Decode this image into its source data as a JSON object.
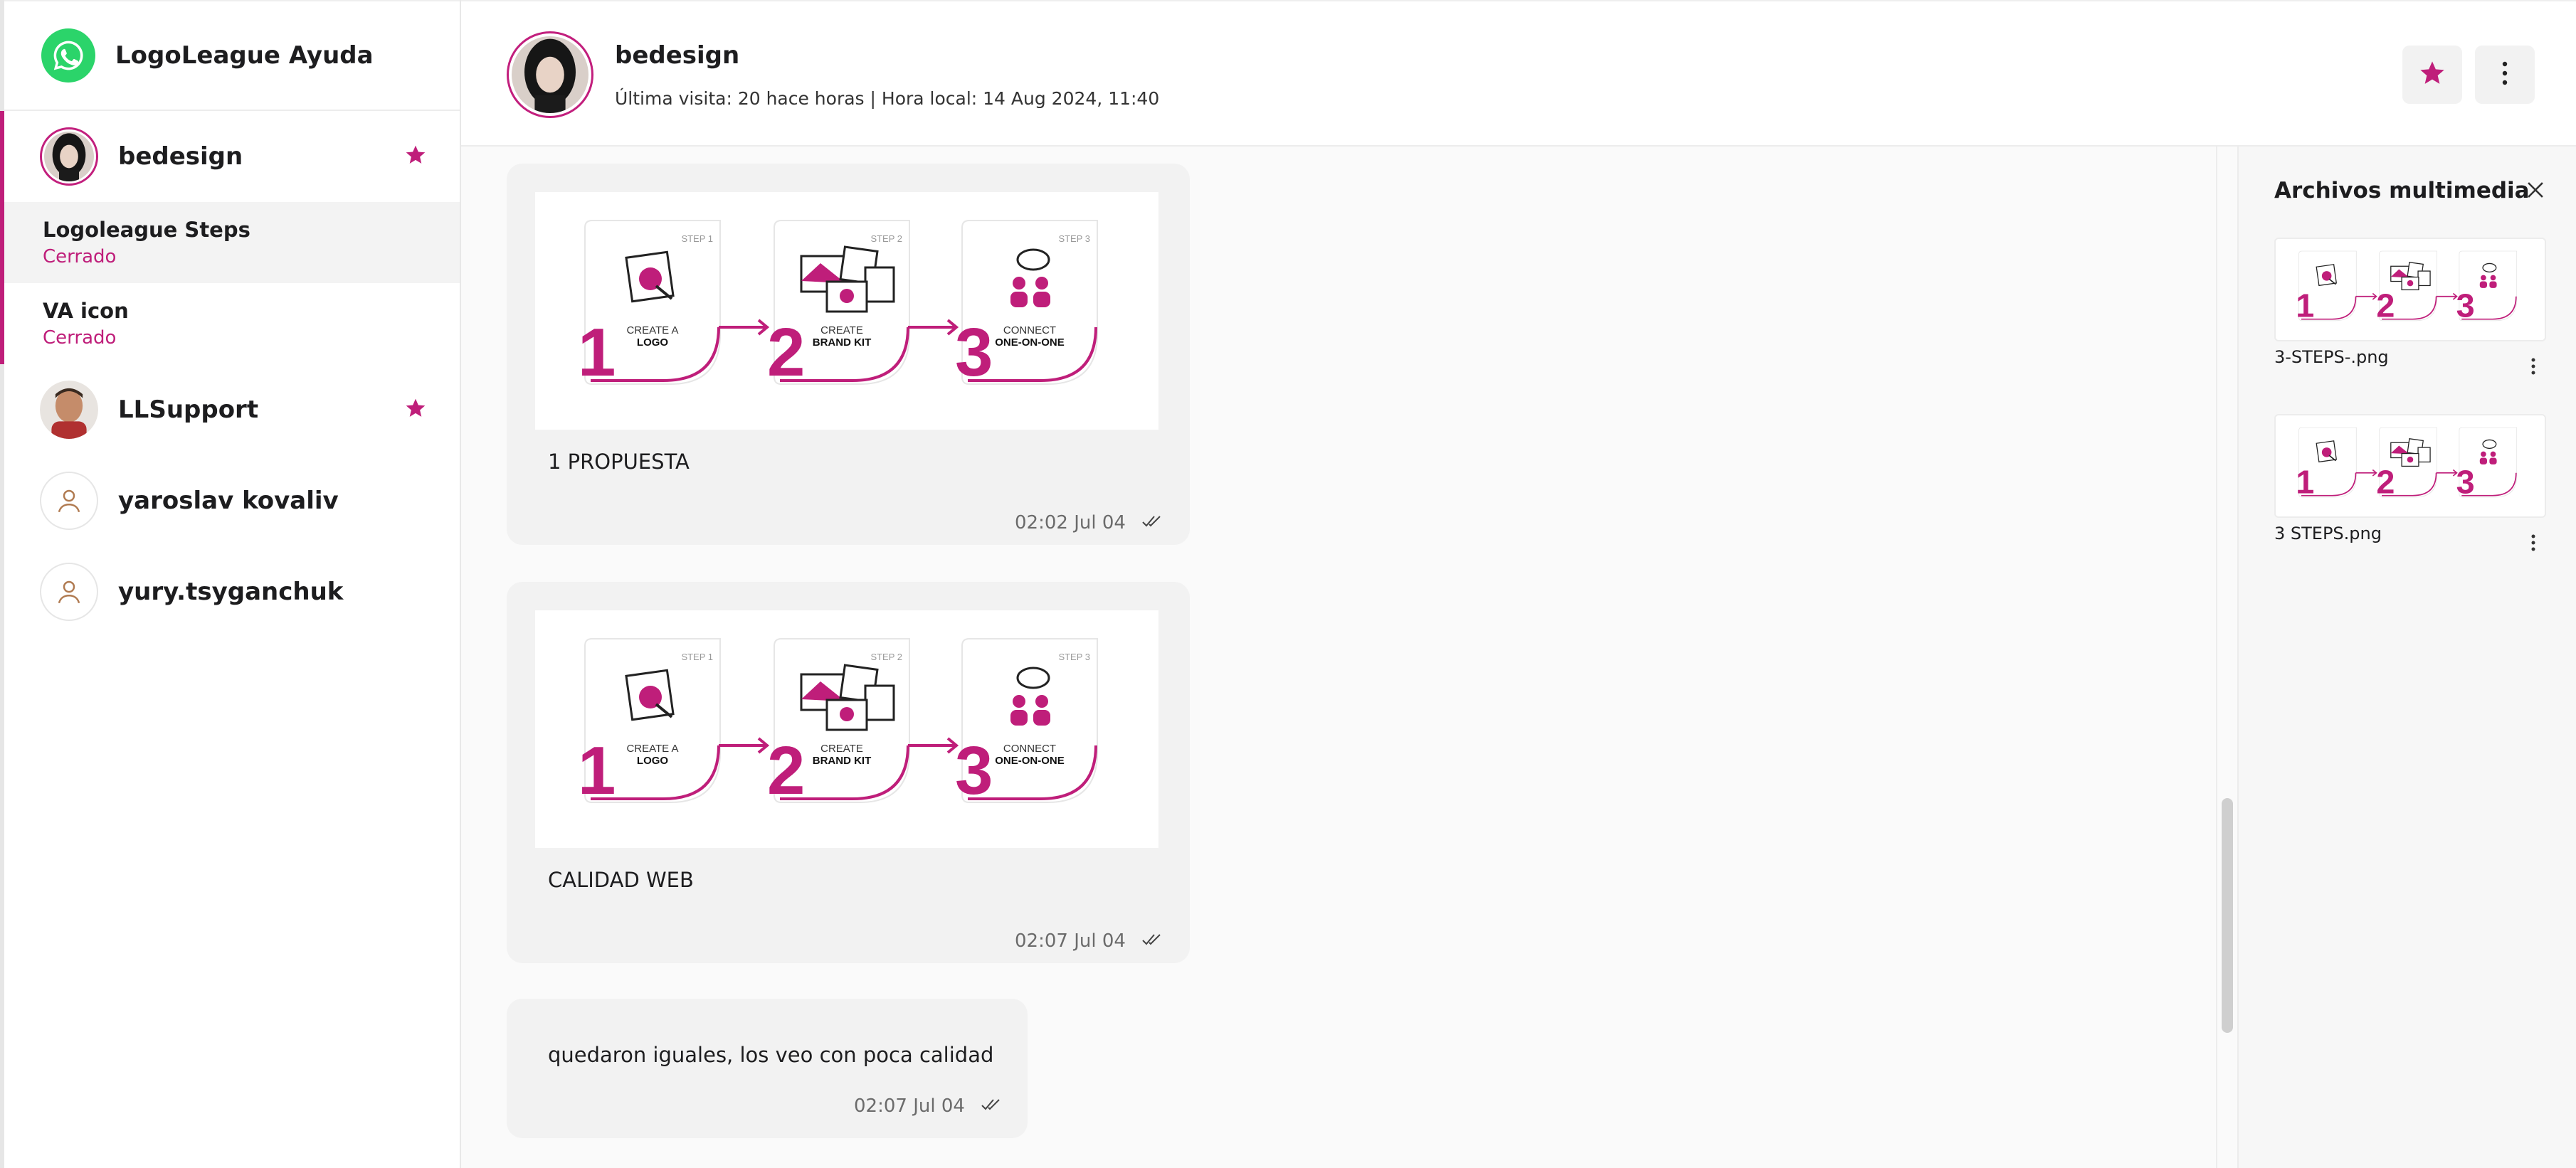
{
  "sidebar": {
    "brand": "LogoLeague Ayuda",
    "contacts": [
      {
        "name": "bedesign",
        "starred": true
      },
      {
        "name": "LLSupport",
        "starred": true
      },
      {
        "name": "yaroslav kovaliv",
        "starred": false
      },
      {
        "name": "yury.tsyganchuk",
        "starred": false
      }
    ],
    "threads": [
      {
        "title": "Logoleague Steps",
        "status": "Cerrado"
      },
      {
        "title": "VA icon",
        "status": "Cerrado"
      }
    ]
  },
  "header": {
    "name": "bedesign",
    "subtitle": "Última visita: 20 hace horas | Hora local: 14 Aug 2024, 11:40"
  },
  "steps_image": {
    "steps": [
      {
        "tag": "STEP 1",
        "number": "1",
        "line1": "CREATE A",
        "line2": "LOGO"
      },
      {
        "tag": "STEP 2",
        "number": "2",
        "line1": "CREATE",
        "line2": "BRAND KIT"
      },
      {
        "tag": "STEP 3",
        "number": "3",
        "line1": "CONNECT",
        "line2": "ONE-ON-ONE"
      }
    ]
  },
  "messages": [
    {
      "caption": "1 PROPUESTA",
      "time": "02:02 Jul 04"
    },
    {
      "caption": "CALIDAD WEB",
      "time": "02:07 Jul 04"
    },
    {
      "text": "quedaron iguales, los veo con poca calidad",
      "time": "02:07 Jul 04"
    }
  ],
  "media": {
    "title": "Archivos multimedia",
    "files": [
      {
        "name": "3-STEPS-.png"
      },
      {
        "name": "3 STEPS.png"
      }
    ]
  },
  "colors": {
    "accent": "#bf1e7a",
    "whatsapp": "#2bd46a"
  }
}
